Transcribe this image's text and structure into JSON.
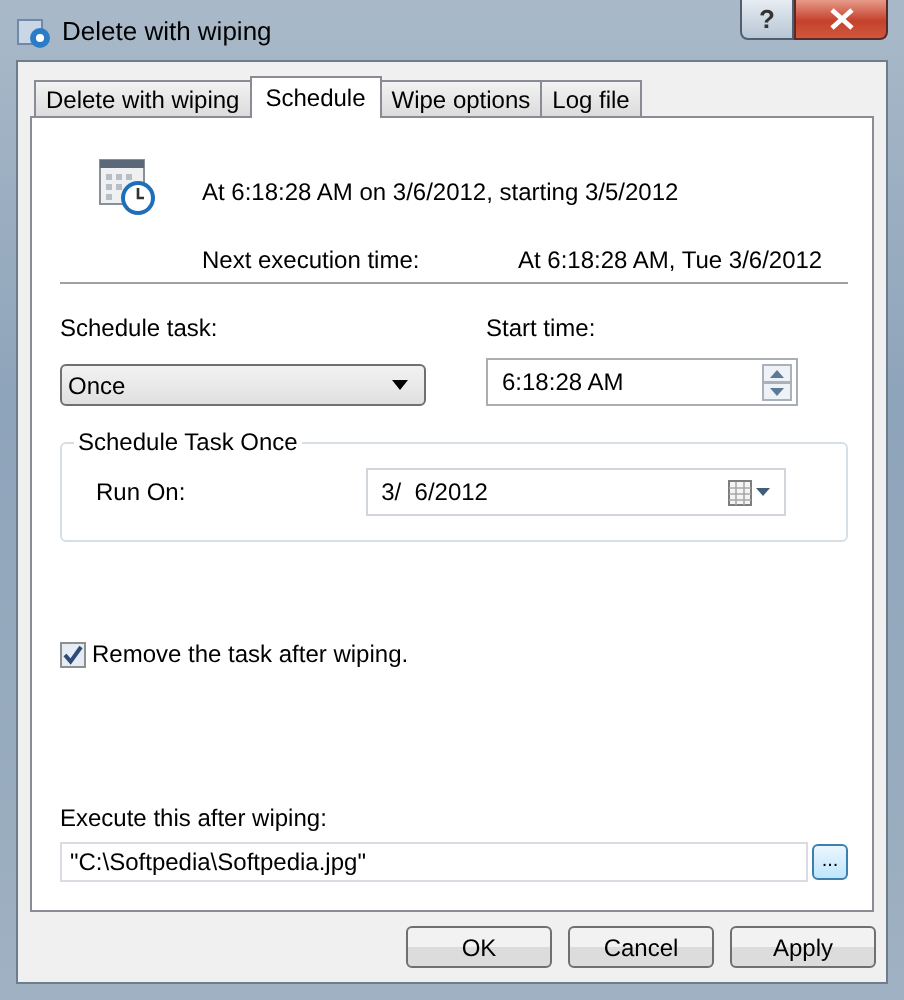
{
  "window": {
    "title": "Delete with wiping",
    "help": "?"
  },
  "tabs": [
    {
      "label": "Delete with wiping",
      "selected": false
    },
    {
      "label": "Schedule",
      "selected": true
    },
    {
      "label": "Wipe options",
      "selected": false
    },
    {
      "label": "Log file",
      "selected": false
    }
  ],
  "schedule": {
    "summary": "At 6:18:28 AM on 3/6/2012, starting 3/5/2012",
    "next_label": "Next execution time:",
    "next_value": "At 6:18:28 AM, Tue 3/6/2012"
  },
  "schedule_task": {
    "label": "Schedule task:",
    "value": "Once"
  },
  "start_time": {
    "label": "Start time:",
    "value": "6:18:28 AM"
  },
  "group": {
    "title": "Schedule Task Once",
    "run_on_label": "Run On:",
    "run_on_value": "3/  6/2012"
  },
  "remove_task": {
    "label": "Remove the task after wiping.",
    "checked": true
  },
  "execute_after": {
    "label": "Execute this after wiping:",
    "value": "\"C:\\Softpedia\\Softpedia.jpg\"",
    "browse": "..."
  },
  "buttons": [
    "OK",
    "Cancel",
    "Apply"
  ]
}
